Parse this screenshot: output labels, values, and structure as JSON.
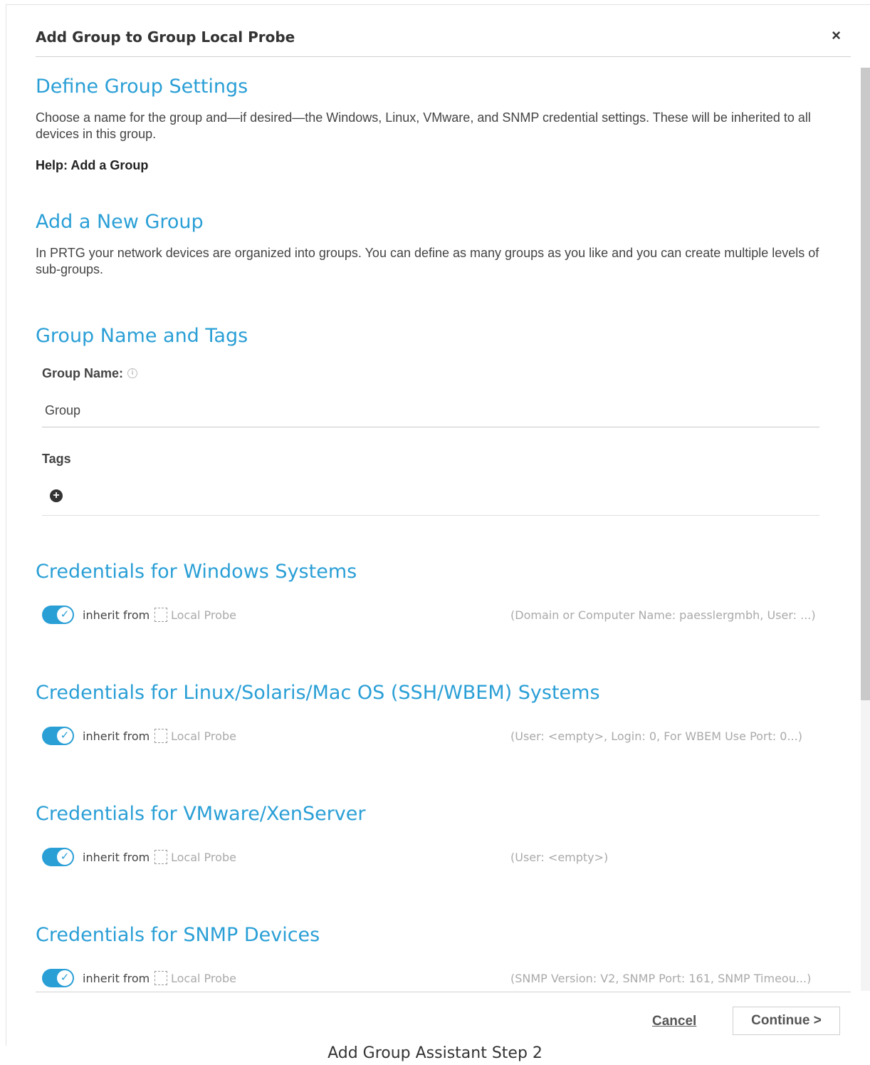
{
  "dialog": {
    "title": "Add Group to Group Local Probe",
    "close_icon": "×"
  },
  "define": {
    "title": "Define Group Settings",
    "description": "Choose a name for the group and—if desired—the Windows, Linux, VMware, and SNMP credential settings. These will be inherited to all devices in this group.",
    "help": "Help: Add a Group"
  },
  "new_group": {
    "title": "Add a New Group",
    "description": "In PRTG your network devices are organized into groups. You can define as many groups as you like and you can create multiple levels of sub-groups."
  },
  "name_tags": {
    "title": "Group Name and Tags",
    "group_name_label": "Group Name:",
    "group_name_value": "Group",
    "tags_label": "Tags",
    "add_tag_icon": "+"
  },
  "credentials": [
    {
      "title": "Credentials for Windows Systems",
      "inherit": true,
      "inherit_label": "inherit from",
      "probe": "Local Probe",
      "info": "(Domain or Computer Name: paesslergmbh, User: ...)"
    },
    {
      "title": "Credentials for Linux/Solaris/Mac OS (SSH/WBEM) Systems",
      "inherit": true,
      "inherit_label": "inherit from",
      "probe": "Local Probe",
      "info": "(User: <empty>, Login: 0, For WBEM Use Port: 0...)"
    },
    {
      "title": "Credentials for VMware/XenServer",
      "inherit": true,
      "inherit_label": "inherit from",
      "probe": "Local Probe",
      "info": "(User: <empty>)"
    },
    {
      "title": "Credentials for SNMP Devices",
      "inherit": true,
      "inherit_label": "inherit from",
      "probe": "Local Probe",
      "info": "(SNMP Version: V2, SNMP Port: 161, SNMP Timeou...)"
    }
  ],
  "footer": {
    "cancel": "Cancel",
    "continue": "Continue >"
  },
  "caption": "Add Group Assistant Step 2",
  "colors": {
    "accent": "#2a9fd6",
    "muted": "#aaaaaa"
  }
}
